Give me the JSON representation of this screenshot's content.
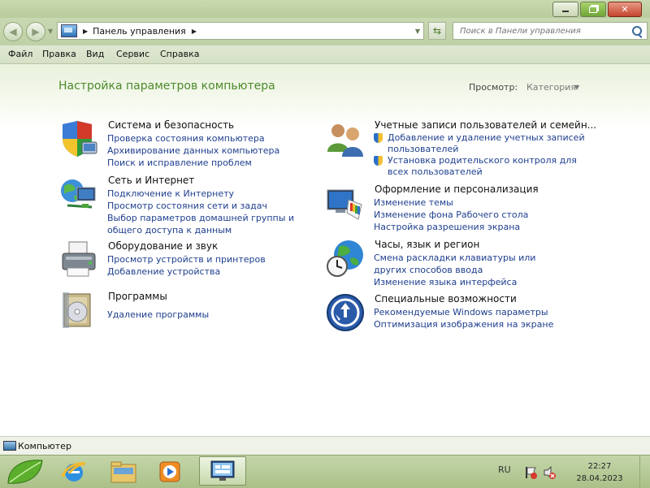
{
  "window": {
    "controls": [
      "minimize",
      "restore",
      "close"
    ]
  },
  "nav": {
    "breadcrumb": "Панель управления",
    "search_placeholder": "Поиск в Панели управления"
  },
  "menu": [
    "Файл",
    "Правка",
    "Вид",
    "Сервис",
    "Справка"
  ],
  "content": {
    "title": "Настройка параметров компьютера",
    "view_by_label": "Просмотр:",
    "view_by_value": "Категория",
    "categories": [
      {
        "title": "Система и безопасность",
        "icon": "shield-security-icon",
        "links": [
          "Проверка состояния компьютера",
          "Архивирование данных компьютера",
          "Поиск и исправление проблем"
        ]
      },
      {
        "title": "Сеть и Интернет",
        "icon": "network-globe-icon",
        "links": [
          "Подключение к Интернету",
          "Просмотр состояния сети и задач",
          "Выбор параметров домашней группы и общего доступа к данным"
        ]
      },
      {
        "title": "Оборудование и звук",
        "icon": "printer-hardware-icon",
        "links": [
          "Просмотр устройств и принтеров",
          "Добавление устройства"
        ]
      },
      {
        "title": "Программы",
        "icon": "programs-disc-icon",
        "links": [
          "Удаление программы"
        ]
      },
      {
        "title": "Учетные записи пользователей и семейн...",
        "icon": "users-icon",
        "links": [
          "Добавление и удаление учетных записей пользователей",
          "Установка родительского контроля для всех пользователей"
        ]
      },
      {
        "title": "Оформление и персонализация",
        "icon": "monitor-palette-icon",
        "links": [
          "Изменение темы",
          "Изменение фона Рабочего стола",
          "Настройка разрешения экрана"
        ]
      },
      {
        "title": "Часы, язык и регион",
        "icon": "clock-globe-icon",
        "links": [
          "Смена раскладки клавиатуры или других способов ввода",
          "Изменение языка интерфейса"
        ]
      },
      {
        "title": "Специальные возможности",
        "icon": "accessibility-icon",
        "links": [
          "Рекомендуемые Windows параметры",
          "Оптимизация изображения на экране"
        ]
      }
    ]
  },
  "status": {
    "text": "Компьютер"
  },
  "taskbar": {
    "lang": "RU",
    "time": "22:27",
    "date": "28.04.2023"
  }
}
